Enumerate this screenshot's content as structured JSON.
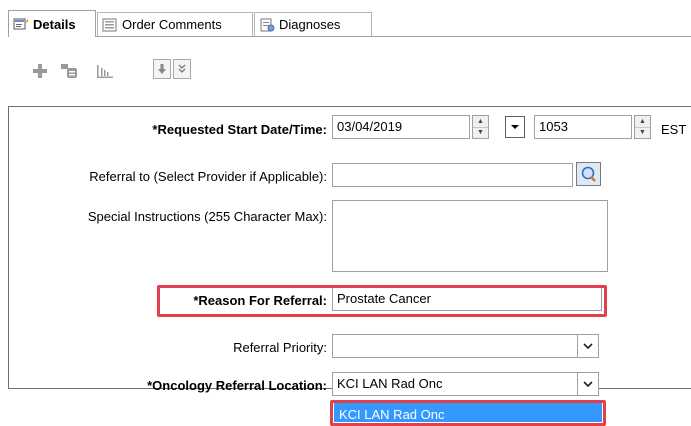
{
  "tabs": [
    {
      "label": "Details",
      "icon": "details-icon",
      "active": true
    },
    {
      "label": "Order Comments",
      "icon": "comments-icon",
      "active": false
    },
    {
      "label": "Diagnoses",
      "icon": "diagnoses-icon",
      "active": false
    }
  ],
  "toolbar": {
    "icons": [
      "add-icon",
      "stethoscope-icon",
      "chart-icon",
      "download-icon",
      "expand-icon"
    ]
  },
  "form": {
    "start_date": {
      "label": "*Requested Start Date/Time:",
      "date": "03/04/2019",
      "time": "1053",
      "tz": "EST"
    },
    "referral_to": {
      "label": "Referral to (Select Provider if Applicable):",
      "value": ""
    },
    "special_instructions": {
      "label": "Special Instructions (255 Character Max):",
      "value": ""
    },
    "reason": {
      "label": "*Reason For Referral:",
      "value": "Prostate Cancer"
    },
    "priority": {
      "label": "Referral Priority:",
      "value": ""
    },
    "location": {
      "label": "*Oncology Referral Location:",
      "value": "KCI LAN Rad Onc",
      "dropdown_option": "KCI LAN Rad Onc"
    }
  },
  "colors": {
    "highlight": "#e2404a",
    "selection": "#3399ff"
  }
}
